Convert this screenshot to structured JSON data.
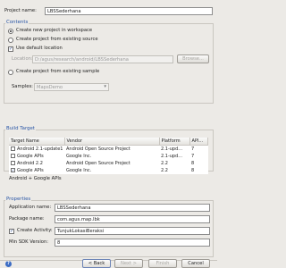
{
  "project_name": {
    "label": "Project name:",
    "value": "LBSSederhana"
  },
  "contents": {
    "legend": "Contents",
    "new_project_label": "Create new project in workspace",
    "existing_source_label": "Create project from existing source",
    "use_default_label": "Use default location",
    "location_label": "Location:",
    "location_value": "D:/agus/research/android/LBSSederhana",
    "browse_label": "Browse...",
    "existing_sample_label": "Create project from existing sample",
    "samples_label": "Samples:",
    "samples_value": "MapsDemo"
  },
  "build_target": {
    "legend": "Build Target",
    "headers": {
      "name": "Target Name",
      "vendor": "Vendor",
      "platform": "Platform",
      "api": "API..."
    },
    "rows": [
      {
        "name": "Android 2.1-update1",
        "vendor": "Android Open Source Project",
        "platform": "2.1-upd...",
        "api": "7",
        "checked": false
      },
      {
        "name": "Google APIs",
        "vendor": "Google Inc.",
        "platform": "2.1-upd...",
        "api": "7",
        "checked": false
      },
      {
        "name": "Android 2.2",
        "vendor": "Android Open Source Project",
        "platform": "2.2",
        "api": "8",
        "checked": false
      },
      {
        "name": "Google APIs",
        "vendor": "Google Inc.",
        "platform": "2.2",
        "api": "8",
        "checked": true
      }
    ],
    "selected_text": "Android + Google APIs"
  },
  "properties": {
    "legend": "Properties",
    "app_name_label": "Application name:",
    "app_name_value": "LBSSederhana",
    "package_label": "Package name:",
    "package_value": "com.agus.map.lbk",
    "create_activity_label": "Create Activity:",
    "create_activity_value": "TunjukLokasiBeraksi",
    "min_sdk_label": "Min SDK Version:",
    "min_sdk_value": "8"
  },
  "footer": {
    "help_glyph": "?",
    "back_label": "< Back",
    "next_label": "Next >",
    "finish_label": "Finish",
    "cancel_label": "Cancel"
  }
}
